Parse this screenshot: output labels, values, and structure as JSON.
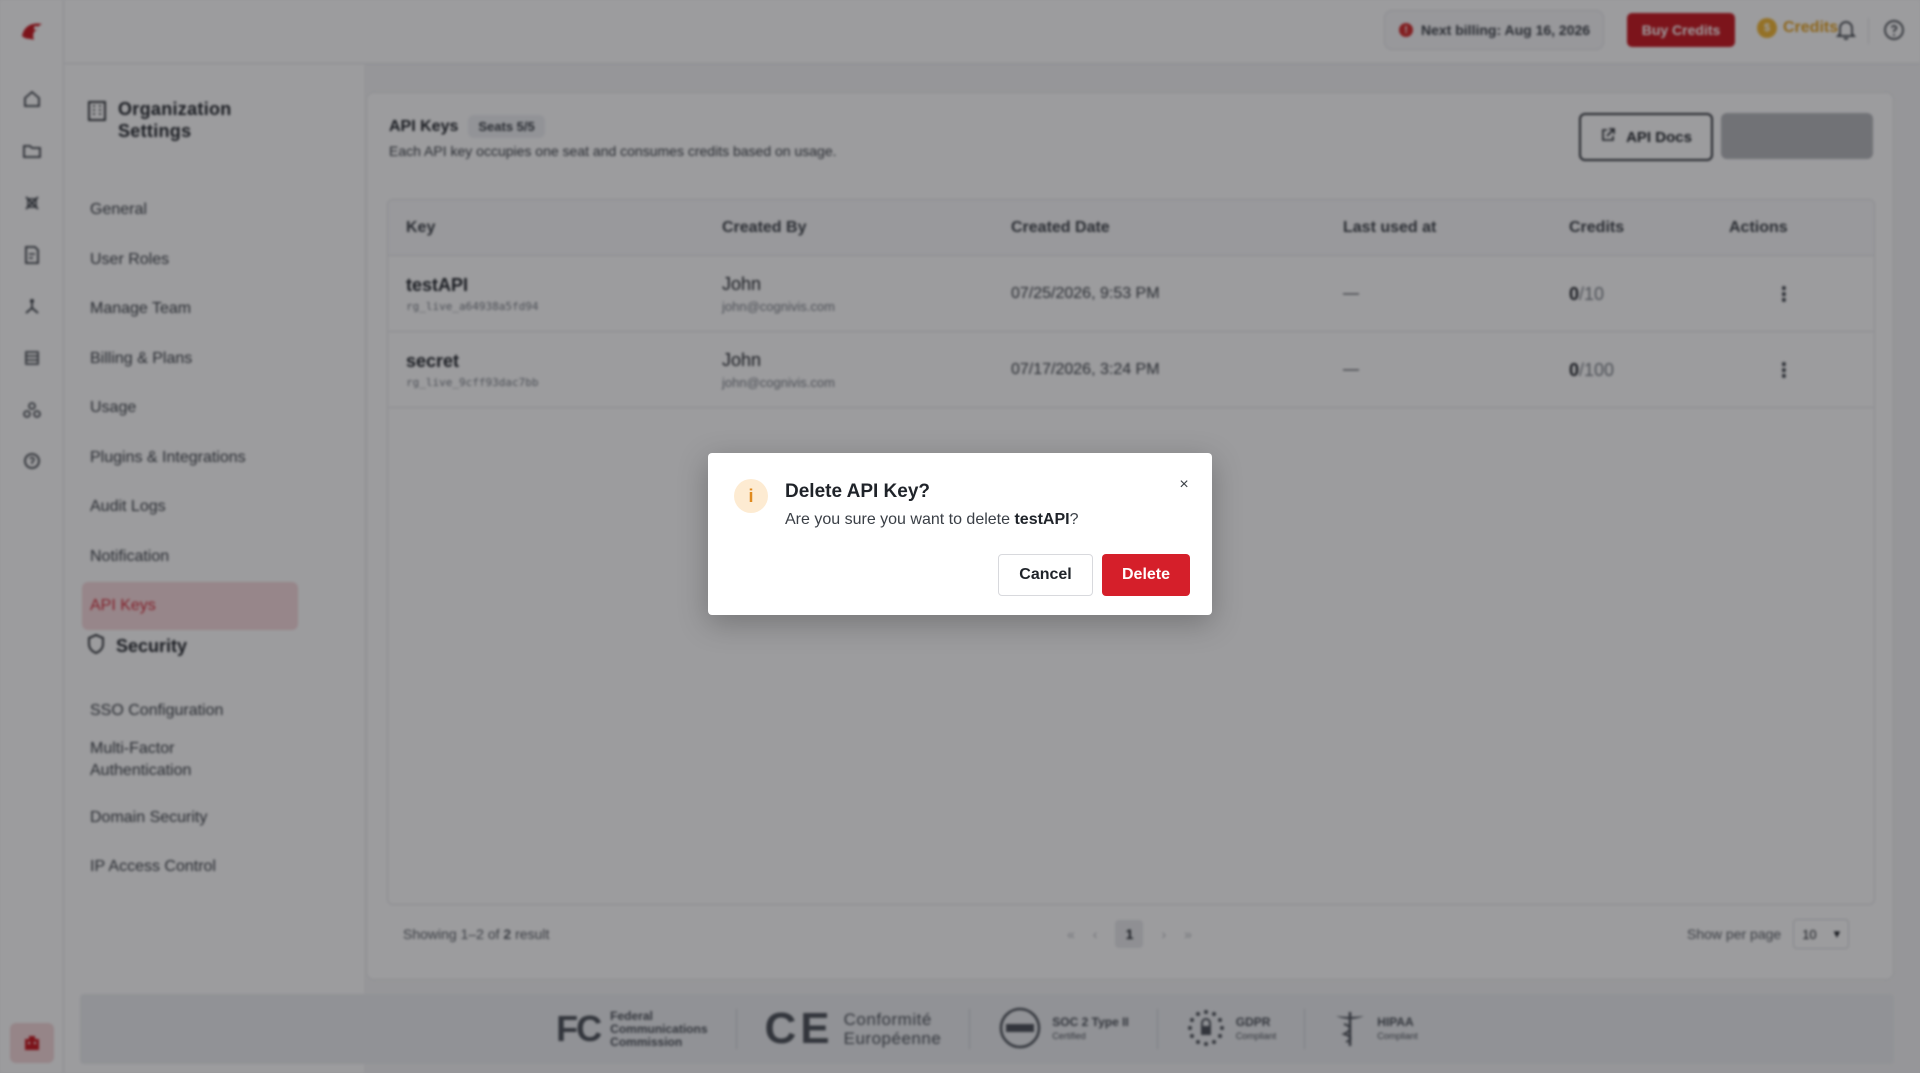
{
  "topbar": {
    "billing": "Next billing: Aug 16, 2026",
    "buy_credits": "Buy Credits",
    "credits": "Credits",
    "coin_symbol": "$"
  },
  "settings_nav": {
    "heading": "Organization Settings",
    "items": [
      {
        "label": "General"
      },
      {
        "label": "User Roles"
      },
      {
        "label": "Manage Team"
      },
      {
        "label": "Billing & Plans"
      },
      {
        "label": "Usage"
      },
      {
        "label": "Plugins & Integrations"
      },
      {
        "label": "Audit Logs"
      },
      {
        "label": "Notification"
      },
      {
        "label": "API Keys"
      }
    ],
    "active_item": "API Keys",
    "security_heading": "Security",
    "security_items": [
      {
        "label": "SSO Configuration"
      },
      {
        "label": "Multi-Factor Authentication"
      },
      {
        "label": "Domain Security"
      },
      {
        "label": "IP Access Control"
      }
    ]
  },
  "main": {
    "title": "API Keys",
    "seats": "Seats 5/5",
    "subtitle": "Each API key occupies one seat and consumes credits based on usage.",
    "api_docs": "API Docs"
  },
  "table": {
    "columns": [
      "Key",
      "Created By",
      "Created Date",
      "Last used at",
      "Credits",
      "Actions"
    ],
    "rows": [
      {
        "key": "testAPI",
        "key_id": "rg_live_a64938a5fd94",
        "user": "John",
        "email": "john@cognivis.com",
        "created": "07/25/2026, 9:53 PM",
        "last_used": "—",
        "credits_used": "0",
        "credits_limit": "/10",
        "action": "⋮"
      },
      {
        "key": "secret",
        "key_id": "rg_live_9cff93dac7bb",
        "user": "John",
        "email": "john@cognivis.com",
        "created": "07/17/2026, 3:24 PM",
        "last_used": "—",
        "credits_used": "0",
        "credits_limit": "/100",
        "action": "⋮"
      }
    ],
    "showing_prefix": "Showing 1–2 of ",
    "showing_total": "2",
    "showing_suffix": " result",
    "current_page": "1",
    "per_page_label": "Show per page",
    "per_page_value": "10"
  },
  "certs": {
    "fcc": [
      "Federal",
      "Communications",
      "Commission"
    ],
    "fcc_mark": "FC",
    "ce_mark": "CE",
    "ce": [
      "Conformité",
      "Européenne"
    ],
    "soc": "SOC 2 Type II",
    "soc_sub": "Certified",
    "gdpr": "GDPR",
    "gdpr_sub": "Compliant",
    "hipaa": "HIPAA",
    "hipaa_sub": "Compliant"
  },
  "modal": {
    "icon": "i",
    "title": "Delete API Key?",
    "body_prefix": "Are you sure you want to delete ",
    "body_target": "testAPI",
    "body_suffix": "?",
    "close": "×",
    "cancel": "Cancel",
    "delete": "Delete"
  },
  "colors": {
    "brand_red": "#c8161e",
    "delete_red": "#d51f2a",
    "active_nav_bg": "#f7d9dc",
    "credits_gold": "#e6a21f",
    "warning_orange": "#e08a1e"
  }
}
